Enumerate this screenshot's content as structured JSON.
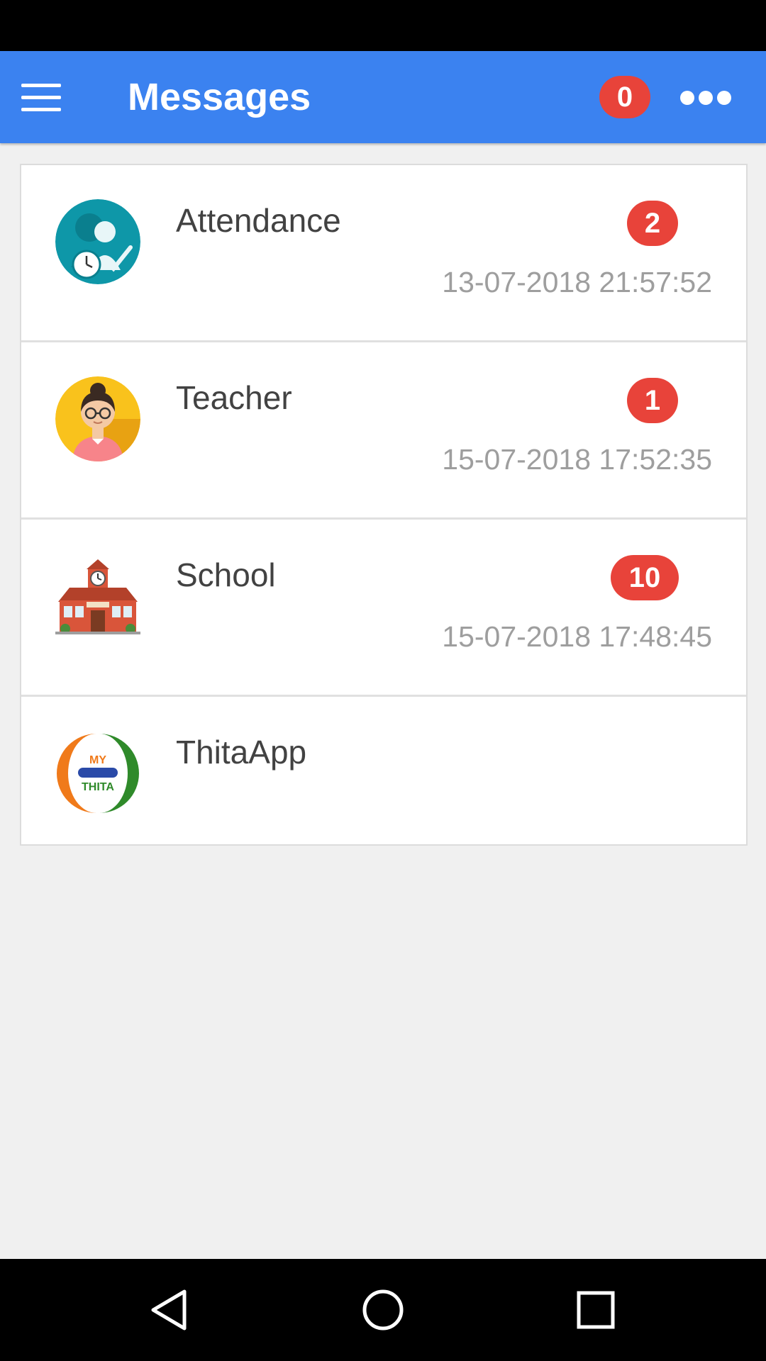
{
  "app_bar": {
    "title": "Messages",
    "notification_count": "0",
    "accent": "#3b82f0",
    "badge_color": "#e8433a"
  },
  "messages": [
    {
      "title": "Attendance",
      "badge": "2",
      "time": "13-07-2018 21:57:52",
      "icon": "attendance-icon"
    },
    {
      "title": "Teacher",
      "badge": "1",
      "time": "15-07-2018 17:52:35",
      "icon": "teacher-icon"
    },
    {
      "title": "School",
      "badge": "10",
      "time": "15-07-2018 17:48:45",
      "icon": "school-icon"
    },
    {
      "title": "ThitaApp",
      "icon": "thita-logo-icon",
      "logo_text": [
        "MY",
        "THITA"
      ]
    }
  ],
  "nav": {
    "back": "back-icon",
    "home": "home-icon",
    "recents": "recents-icon"
  }
}
